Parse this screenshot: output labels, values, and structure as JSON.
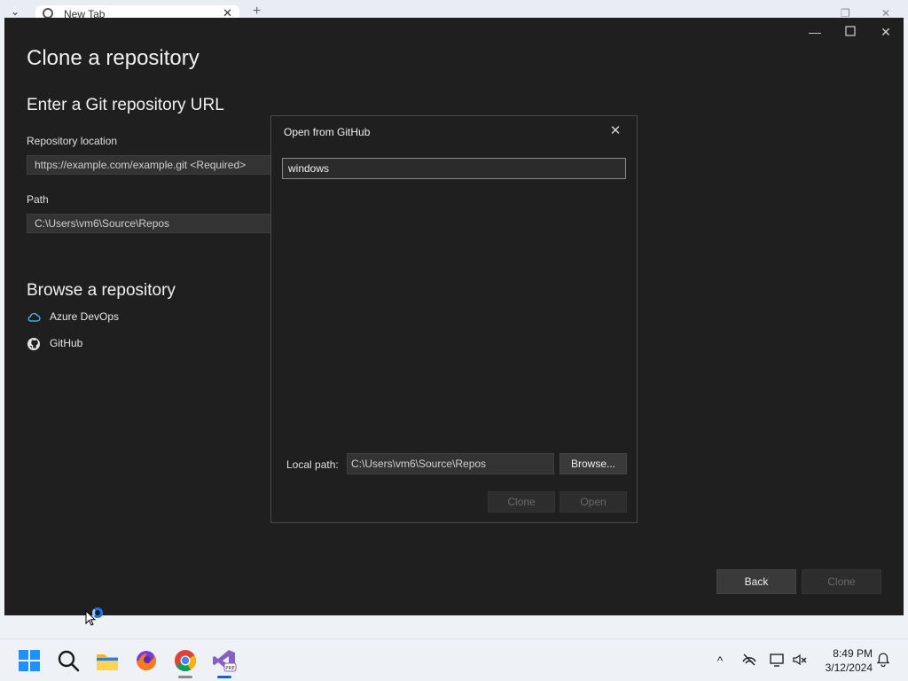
{
  "browser": {
    "tab_label": "New Tab"
  },
  "window": {
    "title": "Clone a repository",
    "git_section": {
      "title": "Enter a Git repository URL",
      "repo_label": "Repository location",
      "repo_placeholder": "https://example.com/example.git <Required>",
      "path_label": "Path",
      "path_value": "C:\\Users\\vm6\\Source\\Repos"
    },
    "browse_section": {
      "title": "Browse a repository",
      "items": [
        {
          "label": "Azure DevOps",
          "icon": "cloud-icon"
        },
        {
          "label": "GitHub",
          "icon": "github-icon"
        }
      ]
    },
    "buttons": {
      "back": "Back",
      "clone": "Clone"
    }
  },
  "dialog": {
    "title": "Open from GitHub",
    "search_value": "windows",
    "local_path_label": "Local path:",
    "local_path_value": "C:\\Users\\vm6\\Source\\Repos",
    "browse_label": "Browse...",
    "clone_label": "Clone",
    "open_label": "Open"
  },
  "taskbar": {
    "apps": [
      {
        "name": "windows-start-icon"
      },
      {
        "name": "search-icon"
      },
      {
        "name": "file-explorer-icon"
      },
      {
        "name": "firefox-icon"
      },
      {
        "name": "chrome-icon"
      },
      {
        "name": "visual-studio-icon"
      }
    ],
    "clock_time": "8:49 PM",
    "clock_date": "3/12/2024"
  },
  "colors": {
    "window_bg": "#1f1f1f",
    "input_bg": "#333333",
    "accent_cloud": "#4fc3f7",
    "taskbar_bg": "#eef2f7"
  }
}
